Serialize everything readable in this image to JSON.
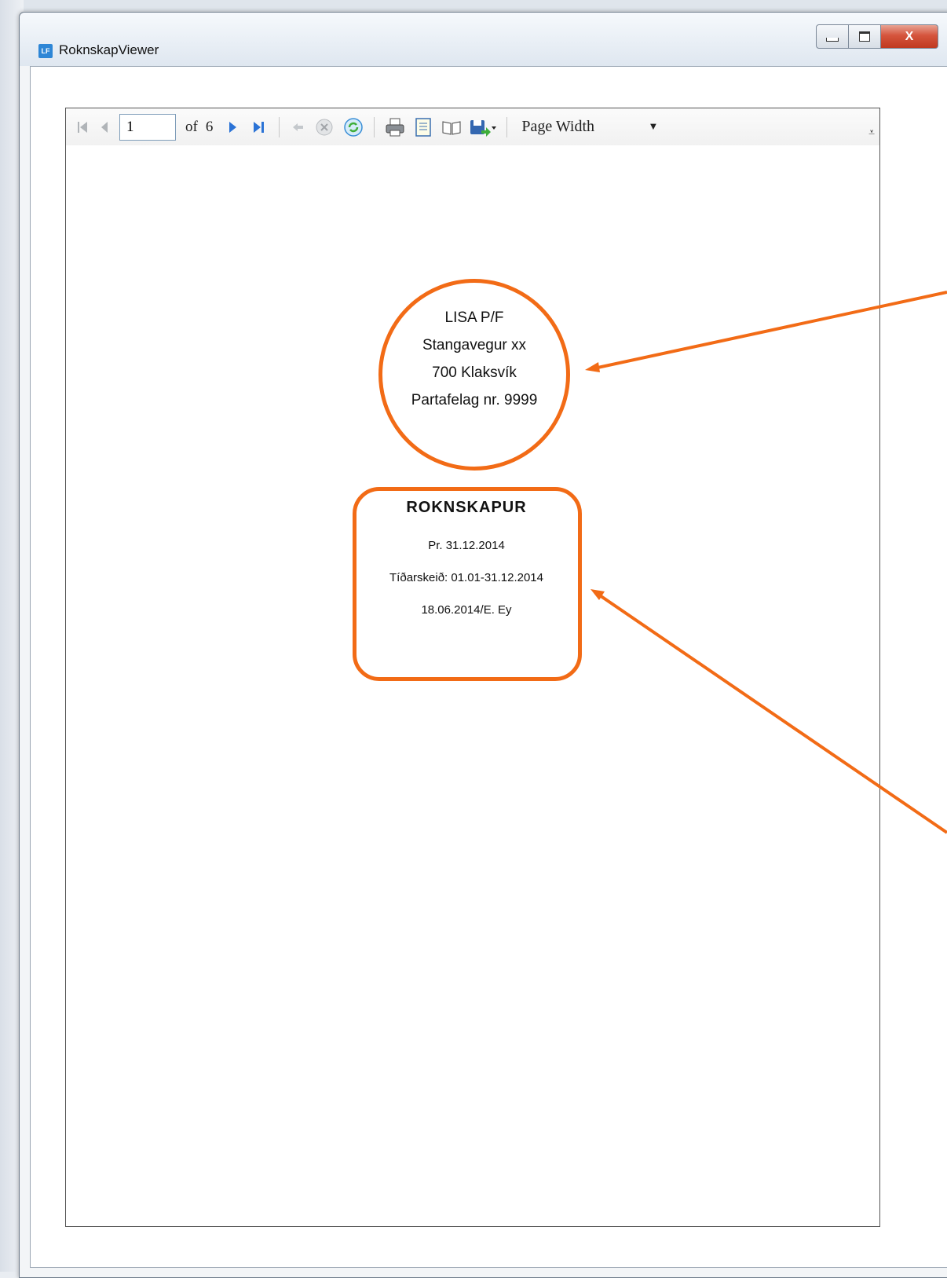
{
  "window": {
    "app_icon": "LF",
    "title": "RoknskapViewer",
    "close_glyph": "X"
  },
  "toolbar": {
    "current_page": "1",
    "of_label": "of",
    "total_pages": "6",
    "zoom": "Page Width",
    "icons": [
      "first-page-icon",
      "previous-page-icon",
      "next-page-icon",
      "last-page-icon",
      "back-icon",
      "stop-icon",
      "refresh-icon",
      "print-icon",
      "print-layout-icon",
      "page-setup-icon",
      "export-icon",
      "overflow-icon"
    ]
  },
  "document": {
    "address": {
      "line1": "LISA P/F",
      "line2": "Stangavegur xx",
      "line3": "700 Klaksvík",
      "line4": "Partafelag nr. 9999"
    },
    "cover": {
      "title": "ROKNSKAPUR",
      "date": "Pr. 31.12.2014",
      "period": "Tíðarskeið: 01.01-31.12.2014",
      "signature": "18.06.2014/E. Ey"
    }
  },
  "annotation_color": "#f26b16"
}
